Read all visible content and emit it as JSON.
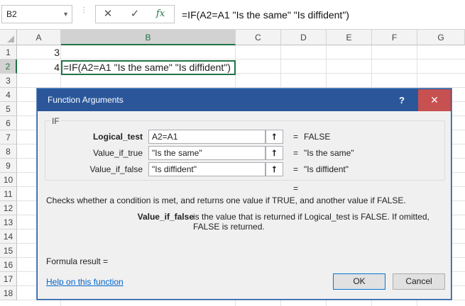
{
  "formula_bar": {
    "name_box": "B2",
    "cancel_icon": "✕",
    "enter_icon": "✓",
    "fx_label": "fx",
    "formula": "=IF(A2=A1 \"Is the same\" \"Is diffident\")"
  },
  "grid": {
    "columns": [
      "A",
      "B",
      "C",
      "D",
      "E",
      "F",
      "G"
    ],
    "rows": [
      "1",
      "2",
      "3",
      "4",
      "5",
      "6",
      "7",
      "8",
      "9",
      "10",
      "11",
      "12",
      "13",
      "14",
      "15",
      "16",
      "17",
      "18"
    ],
    "cells": {
      "a1": "3",
      "a2": "4",
      "b2": "=IF(A2=A1 \"Is the same\" \"Is diffident\")"
    }
  },
  "dialog": {
    "title": "Function Arguments",
    "help_label": "?",
    "close_label": "✕",
    "function_name": "IF",
    "args": [
      {
        "label": "Logical_test",
        "value": "A2=A1",
        "result": "FALSE"
      },
      {
        "label": "Value_if_true",
        "value": "\"Is the same\"",
        "result": "\"Is the same\""
      },
      {
        "label": "Value_if_false",
        "value": "\"Is diffident\"",
        "result": "\"Is diffident\""
      }
    ],
    "eq_sign": "=",
    "ref_icon": "⭡",
    "description": "Checks whether a condition is met, and returns one value if TRUE, and another value if FALSE.",
    "current_arg_name": "Value_if_false",
    "current_arg_desc": "is the value that is returned if Logical_test is FALSE. If omitted, FALSE is returned.",
    "formula_result": "Formula result =",
    "help_link": "Help on this function",
    "ok_label": "OK",
    "cancel_label": "Cancel"
  },
  "colors": {
    "excel_green": "#217346",
    "dialog_titlebar": "#2b579a",
    "close_red": "#c75050",
    "link": "#0066cc"
  }
}
